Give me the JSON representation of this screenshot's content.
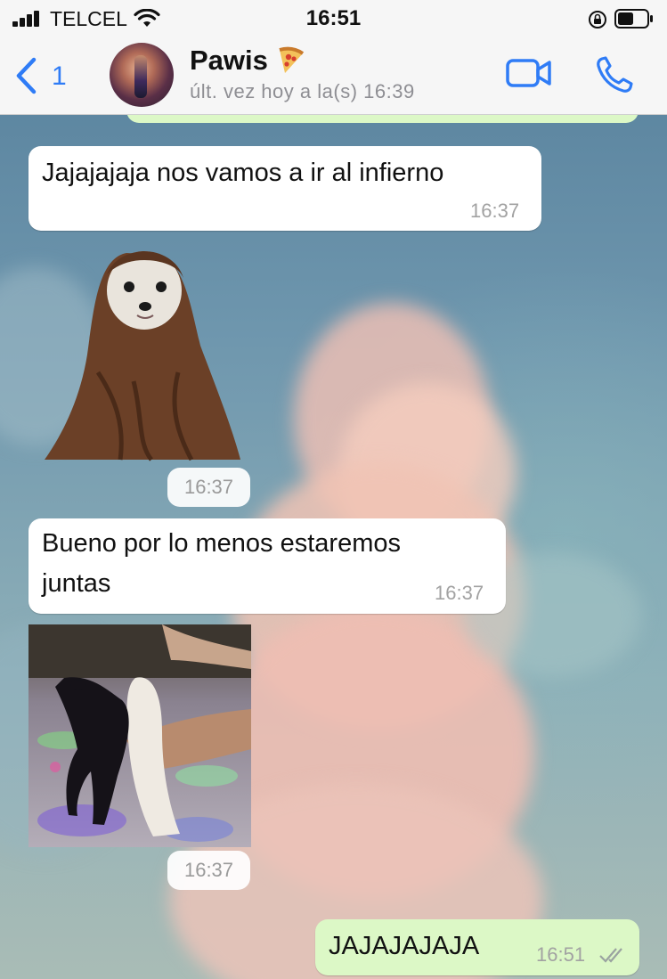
{
  "status_bar": {
    "carrier": "TELCEL",
    "time": "16:51"
  },
  "header": {
    "back_count": "1",
    "contact_name": "Pawis",
    "last_seen": "últ. vez hoy a la(s) 16:39"
  },
  "messages": [
    {
      "type": "text",
      "direction": "in",
      "text": "Jajajajaja nos vamos a ir al infierno",
      "time": "16:37"
    },
    {
      "type": "sticker",
      "direction": "in",
      "description_icon": "hooded-dog-sticker",
      "time": "16:37"
    },
    {
      "type": "text",
      "direction": "in",
      "text_line1": "Bueno por lo menos estaremos",
      "text_line2": "juntas",
      "time": "16:37"
    },
    {
      "type": "image",
      "direction": "in",
      "description_icon": "dancing-dog-photo",
      "time": "16:37"
    },
    {
      "type": "text",
      "direction": "out",
      "text": "JAJAJAJAJA",
      "time": "16:51",
      "status": "read"
    }
  ],
  "colors": {
    "accent": "#2f7cf6",
    "incoming_bubble": "#ffffff",
    "outgoing_bubble": "#dcf8c6",
    "bar_background": "#f6f6f6"
  }
}
